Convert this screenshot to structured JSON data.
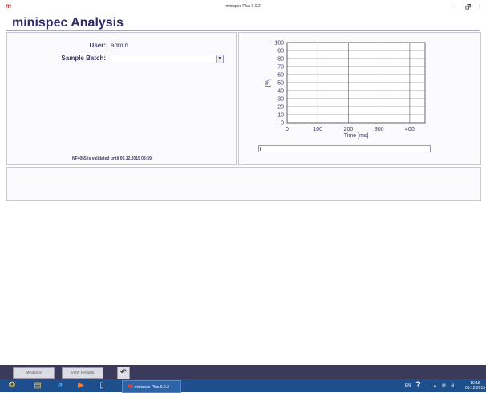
{
  "window": {
    "logo_text": "m",
    "title": "minispec Plus 6.0.2",
    "minimize": "–",
    "maximize": "🗗",
    "close": "›"
  },
  "page": {
    "title": "minispec Analysis"
  },
  "left_panel": {
    "user_label": "User:",
    "user_value": "admin",
    "sample_batch_label": "Sample Batch:",
    "sample_batch_value": "",
    "validation_note": "NF4055 is validated until 09.12.2015 08:59"
  },
  "chart_data": {
    "type": "line",
    "xlabel": "Time [ms]",
    "ylabel": "[%]",
    "xlim": [
      0,
      450
    ],
    "ylim": [
      0,
      100
    ],
    "x_ticks": [
      0,
      100,
      200,
      300,
      400
    ],
    "y_ticks": [
      0,
      10,
      20,
      30,
      40,
      50,
      60,
      70,
      80,
      90,
      100
    ],
    "grid": true,
    "series": []
  },
  "progress": {
    "value": 0.0
  },
  "buttons": {
    "measure": "Measure",
    "view_results": "View Results",
    "undo_icon": "undo-arrow-icon"
  },
  "taskbar": {
    "task_label": "minispec Plus 6.0.2",
    "language": "EN",
    "time": "10:18",
    "date": "09.12.2015"
  }
}
